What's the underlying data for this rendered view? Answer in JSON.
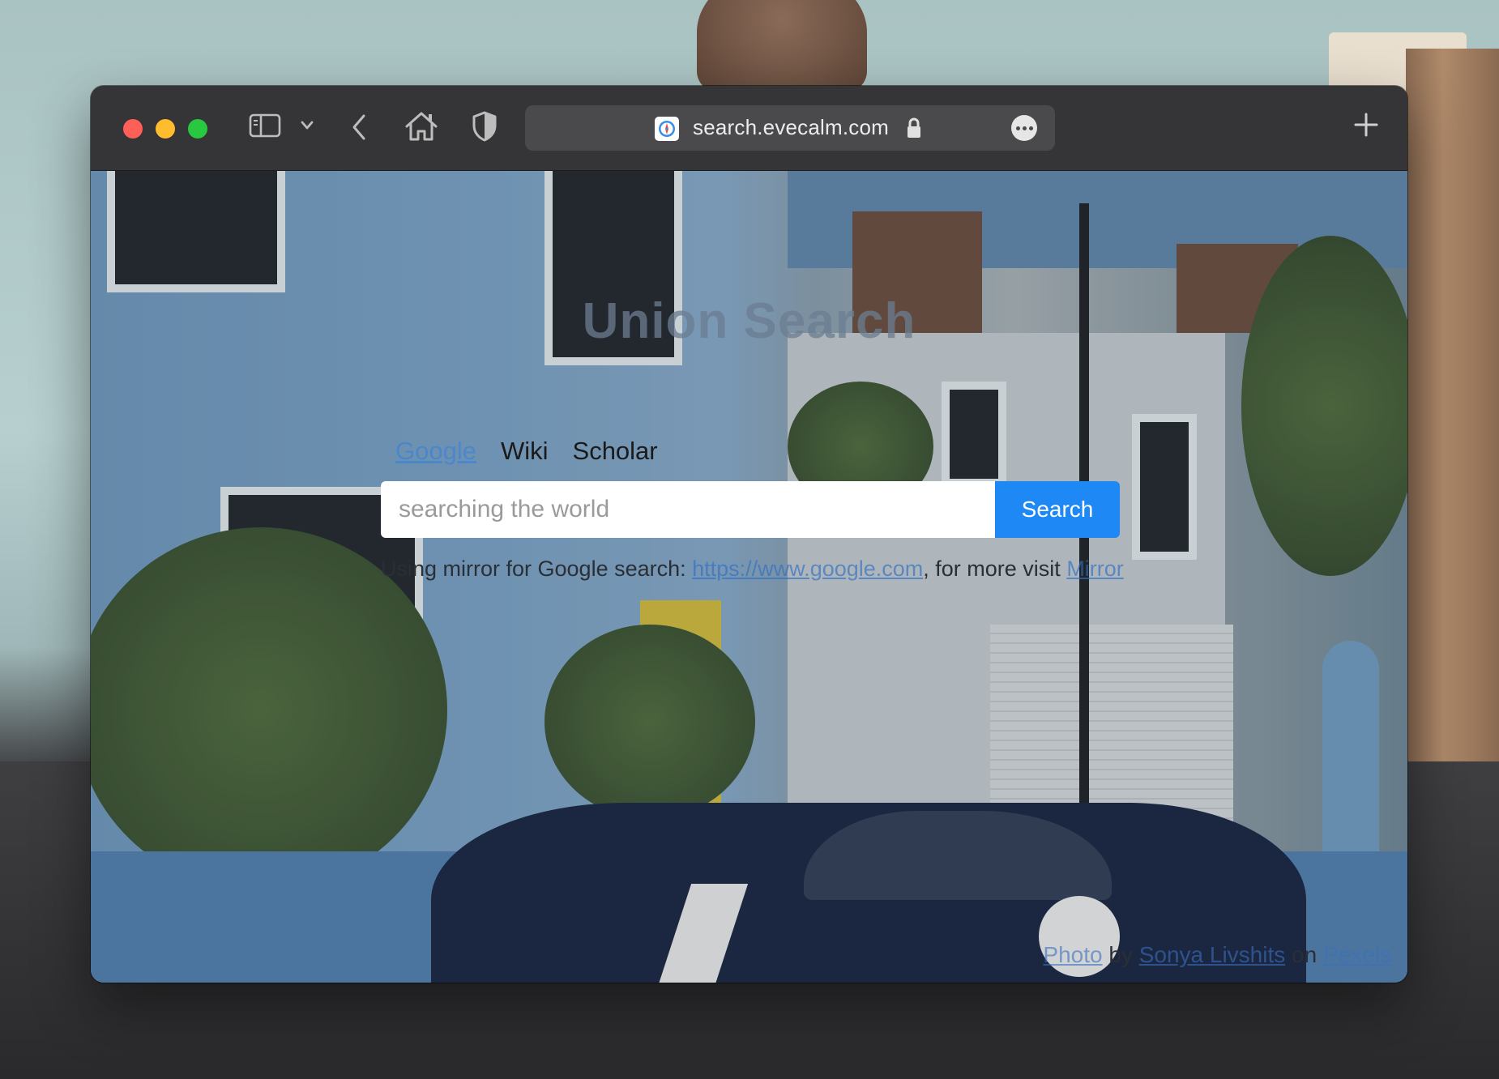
{
  "browser": {
    "address_url": "search.evecalm.com",
    "icons": {
      "sidebar": "sidebar-icon",
      "chevron": "chevron-down-icon",
      "back": "back-arrow-icon",
      "home": "home-icon",
      "shield": "shield-icon",
      "lock": "lock-icon",
      "more": "ellipsis-icon",
      "new_tab": "plus-icon"
    }
  },
  "page": {
    "title": "Union Search",
    "tabs": [
      {
        "label": "Google",
        "active": true
      },
      {
        "label": "Wiki",
        "active": false
      },
      {
        "label": "Scholar",
        "active": false
      }
    ],
    "search": {
      "placeholder": "searching the world",
      "value": "",
      "button_label": "Search"
    },
    "mirror_note": {
      "prefix": "Using mirror for Google search: ",
      "link": "https://www.google.com",
      "middle": ", for more visit ",
      "more_link": "Mirror"
    },
    "credit": {
      "photo_label": "Photo",
      "by": " by ",
      "author": "Sonya Livshits",
      "on": " on ",
      "source": "Pexels"
    }
  },
  "colors": {
    "accent": "#1e88f5",
    "traffic_red": "#fe5f57",
    "traffic_yellow": "#febc2e",
    "traffic_green": "#28c840"
  }
}
